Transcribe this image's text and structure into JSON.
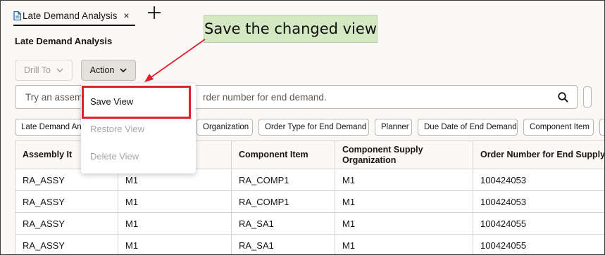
{
  "tab": {
    "title": "Late Demand Analysis",
    "close_glyph": "×",
    "add_glyph": "+"
  },
  "page": {
    "title": "Late Demand Analysis"
  },
  "toolbar": {
    "drill_label": "Drill To",
    "action_label": "Action"
  },
  "search": {
    "placeholder_left": "Try an assemb",
    "placeholder_right": "rder number for end demand."
  },
  "chips": [
    "Late Demand Ana",
    "Organization",
    "Order Type for End Demand",
    "Planner",
    "Due Date of End Demand",
    "Component Item"
  ],
  "table": {
    "headers": [
      "Assembly It",
      "",
      "Component Item",
      "Component Supply Organization",
      "Order Number for End Supply"
    ],
    "rows": [
      [
        "RA_ASSY",
        "M1",
        "RA_COMP1",
        "M1",
        "100424053"
      ],
      [
        "RA_ASSY",
        "M1",
        "RA_COMP1",
        "M1",
        "100424053"
      ],
      [
        "RA_ASSY",
        "M1",
        "RA_SA1",
        "M1",
        "100424055"
      ],
      [
        "RA_ASSY",
        "M1",
        "RA_SA1",
        "M1",
        "100424055"
      ]
    ]
  },
  "menu": {
    "items": [
      {
        "label": "Save View",
        "enabled": true
      },
      {
        "label": "Restore View",
        "enabled": false
      },
      {
        "label": "Delete View",
        "enabled": false
      }
    ]
  },
  "callout": {
    "text": "Save the changed view"
  },
  "colors": {
    "highlight_border": "#e0202a",
    "callout_bg": "#d4e8c4",
    "page_bg": "#fbf9f8"
  },
  "icons": [
    "document-icon",
    "close-icon",
    "plus-icon",
    "chevron-down-icon",
    "search-icon"
  ]
}
